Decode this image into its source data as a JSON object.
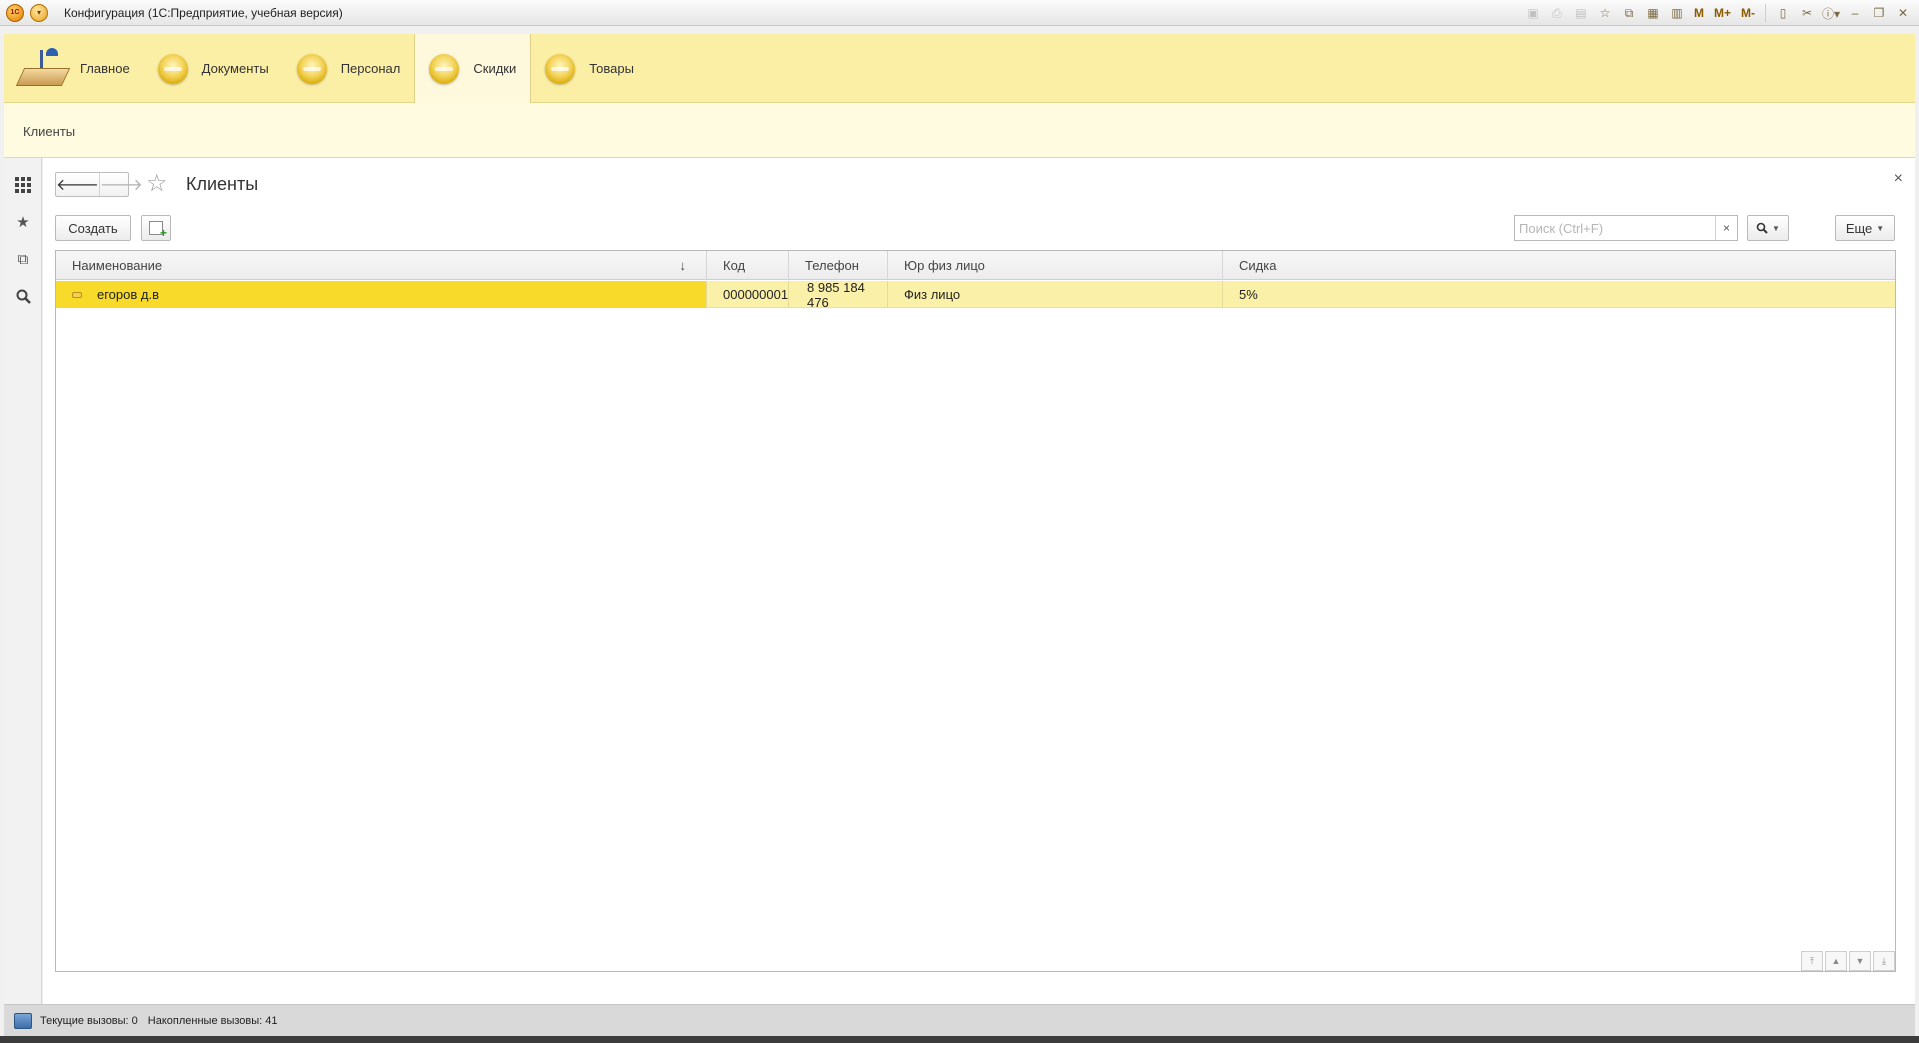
{
  "window": {
    "title": "Конфигурация  (1С:Предприятие, учебная версия)",
    "tools_text": [
      "M",
      "M+",
      "M-"
    ]
  },
  "sections": [
    {
      "label": "Главное",
      "icon": "desk-lamp-icon"
    },
    {
      "label": "Документы",
      "icon": "yellow-disc-icon"
    },
    {
      "label": "Персонал",
      "icon": "yellow-disc-icon"
    },
    {
      "label": "Скидки",
      "icon": "yellow-disc-icon",
      "active": true
    },
    {
      "label": "Товары",
      "icon": "yellow-disc-icon"
    }
  ],
  "function_panel": {
    "items": [
      "Клиенты"
    ]
  },
  "form": {
    "title": "Клиенты",
    "create_label": "Создать",
    "search_placeholder": "Поиск (Ctrl+F)",
    "search_clear": "×",
    "more_label": "Еще",
    "close_glyph": "×"
  },
  "table": {
    "columns": [
      "Наименование",
      "Код",
      "Телефон",
      "Юр физ лицо",
      "Сидка"
    ],
    "sort_indicator": "↓",
    "rows": [
      {
        "name": "егоров д.в",
        "code": "000000001",
        "phone": "8 985 184 476",
        "entity": "Физ лицо",
        "discount": "5%"
      }
    ]
  },
  "status_bar": {
    "current_calls": "Текущие вызовы: 0",
    "accumulated_calls": "Накопленные вызовы: 41"
  },
  "colors": {
    "sections_bg": "#fbeea5",
    "active_section_bg": "#fef9dc",
    "row_bg": "#fbf0a8",
    "selected_cell": "#f8da2a"
  }
}
